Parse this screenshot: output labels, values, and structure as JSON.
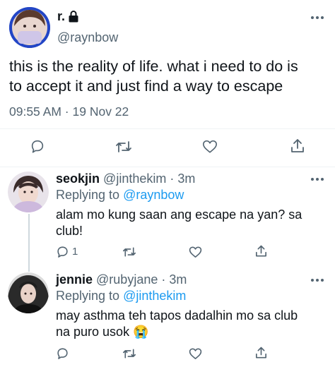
{
  "main_tweet": {
    "author_name": "r.",
    "author_handle": "@raynbow",
    "text_line1": "this is the reality of life. what i need to do is",
    "text_line2": "to accept it and just find a way to escape",
    "timestamp": "09:55 AM · 19 Nov 22",
    "icons": [
      "lock-icon",
      "more-icon",
      "reply-icon",
      "retweet-icon",
      "like-icon",
      "share-icon"
    ]
  },
  "replies": [
    {
      "author_name": "seokjin",
      "author_handle": "@jinthekim",
      "time": "· 3m",
      "replying_prefix": "Replying to ",
      "replying_to": "@raynbow",
      "text_line1": "alam mo kung saan ang escape na yan? sa",
      "text_line2": "club!",
      "reply_count": "1"
    },
    {
      "author_name": "jennie",
      "author_handle": "@rubyjane",
      "time": "· 3m",
      "replying_prefix": "Replying to ",
      "replying_to": "@jinthekim",
      "text_line1": "may asthma teh tapos dadalhin mo sa club",
      "text_line2": "na puro usok 😭",
      "reply_count": ""
    }
  ],
  "colors": {
    "accent": "#1d9bf0",
    "muted": "#536471",
    "text": "#0f1419",
    "divider": "#eff3f4"
  }
}
